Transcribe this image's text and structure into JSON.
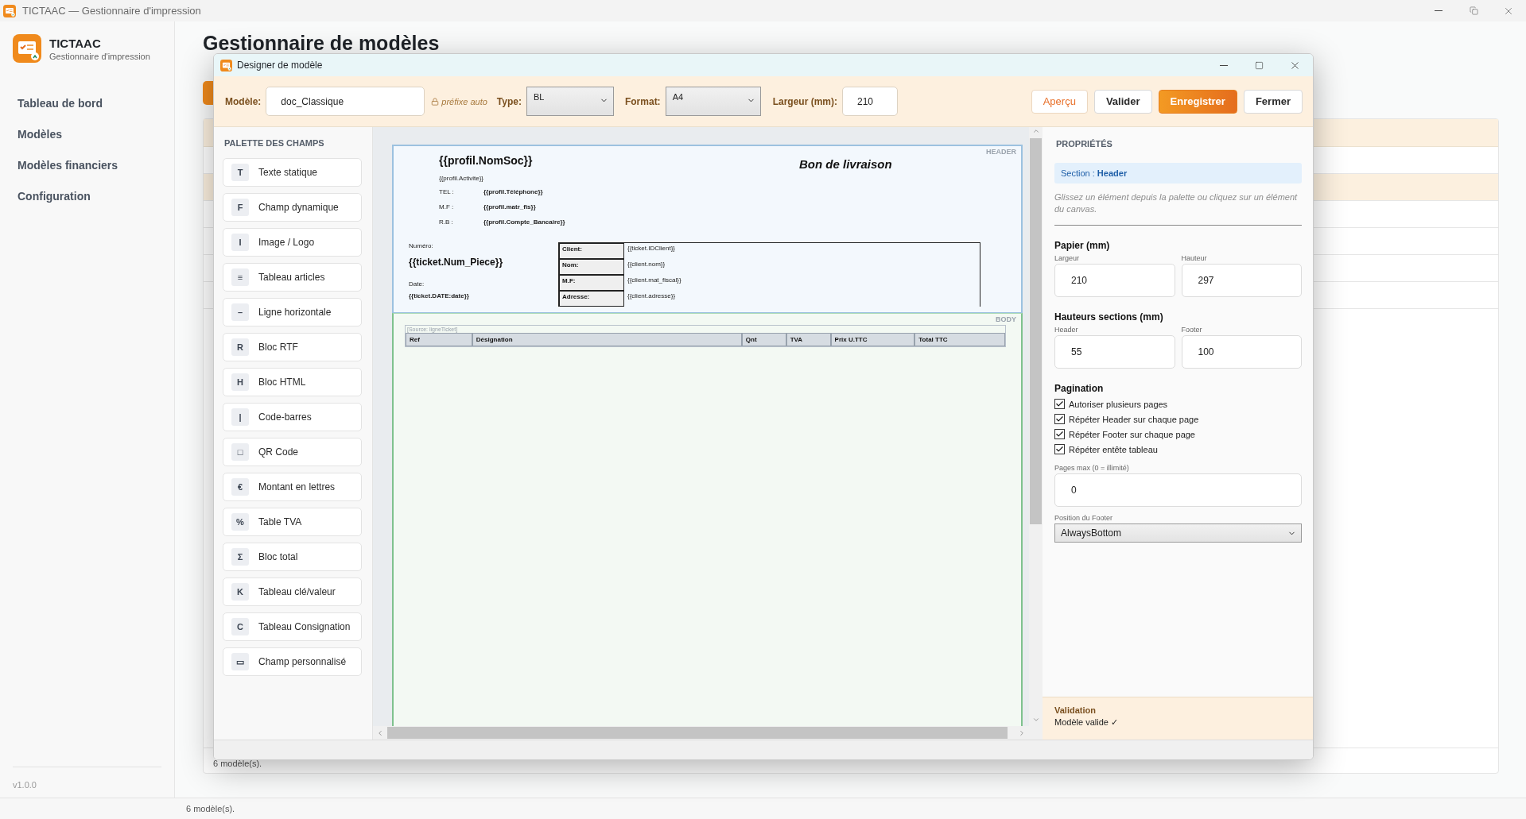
{
  "app_window": {
    "title": "TICTAAC — Gestionnaire d'impression"
  },
  "sidebar": {
    "app_name": "TICTAAC",
    "app_subtitle": "Gestionnaire d'impression",
    "items": [
      {
        "label": "Tableau de bord"
      },
      {
        "label": "Modèles"
      },
      {
        "label": "Modèles financiers"
      },
      {
        "label": "Configuration"
      }
    ],
    "version": "v1.0.0"
  },
  "main": {
    "title": "Gestionnaire de modèles",
    "table_rows": [
      {
        "selected": false
      },
      {
        "selected": true
      },
      {
        "selected": false
      },
      {
        "selected": false
      },
      {
        "selected": false
      },
      {
        "selected": false
      }
    ],
    "list_footer": "6 modèle(s)."
  },
  "status_bar": {
    "text": "6 modèle(s)."
  },
  "dialog": {
    "title": "Designer de modèle",
    "toolbar": {
      "model_label": "Modèle:",
      "model_value": "doc_Classique",
      "prefix_hint": "préfixe auto",
      "type_label": "Type:",
      "type_value": "BL",
      "format_label": "Format:",
      "format_value": "A4",
      "width_label": "Largeur (mm):",
      "width_value": "210",
      "buttons": [
        {
          "label": "Aperçu",
          "kind": "outline"
        },
        {
          "label": "Valider",
          "kind": "plain"
        },
        {
          "label": "Enregistrer",
          "kind": "primary"
        },
        {
          "label": "Fermer",
          "kind": "plain"
        }
      ]
    },
    "palette": {
      "title": "PALETTE DES CHAMPS",
      "items": [
        {
          "glyph": "T",
          "label": "Texte statique"
        },
        {
          "glyph": "F",
          "label": "Champ dynamique"
        },
        {
          "glyph": "I",
          "label": "Image / Logo"
        },
        {
          "glyph": "≡",
          "label": "Tableau articles"
        },
        {
          "glyph": "–",
          "label": "Ligne horizontale"
        },
        {
          "glyph": "R",
          "label": "Bloc RTF"
        },
        {
          "glyph": "H",
          "label": "Bloc HTML"
        },
        {
          "glyph": "|",
          "label": "Code-barres"
        },
        {
          "glyph": "□",
          "label": "QR Code"
        },
        {
          "glyph": "€",
          "label": "Montant en lettres"
        },
        {
          "glyph": "%",
          "label": "Table TVA"
        },
        {
          "glyph": "Σ",
          "label": "Bloc total"
        },
        {
          "glyph": "K",
          "label": "Tableau clé/valeur"
        },
        {
          "glyph": "C",
          "label": "Tableau Consignation"
        },
        {
          "glyph": "▭",
          "label": "Champ personnalisé"
        }
      ]
    },
    "canvas": {
      "header_section": {
        "label": "HEADER",
        "company": "{{profil.NomSoc}}",
        "activity": "{{profil.Activite}}",
        "info_rows": [
          {
            "label": "TEL :",
            "value": "{{profil.Téléphone}}"
          },
          {
            "label": "M.F :",
            "value": "{{profil.matr_fis}}"
          },
          {
            "label": "R.B :",
            "value": "{{profil.Compte_Bancaire}}"
          }
        ],
        "doc_title": "Bon de livraison",
        "number_label": "Numéro:",
        "number_value": "{{ticket.Num_Piece}}",
        "date_label": "Date:",
        "date_value": "{{ticket.DATE:date}}",
        "client_rows": [
          {
            "label": "Client:",
            "value": "{{ticket.IDClient}}"
          },
          {
            "label": "Nom:",
            "value": "{{client.nom}}"
          },
          {
            "label": "M.F:",
            "value": "{{client.mat_fiscal}}"
          },
          {
            "label": "Adresse:",
            "value": "{{client.adresse}}"
          }
        ]
      },
      "body_section": {
        "label": "BODY",
        "source": "[Source: ligneTicket]",
        "columns": [
          "Ref",
          "Désignation",
          "Qnt",
          "TVA",
          "Prix U.TTC",
          "Total TTC"
        ]
      }
    },
    "properties": {
      "title": "PROPRIÉTÉS",
      "section": "Section : **Header**",
      "hint": "Glissez un élément depuis la palette ou cliquez sur un élément du canvas.",
      "paper": {
        "title": "Papier (mm)",
        "fields": [
          {
            "label": "Largeur",
            "value": "210"
          },
          {
            "label": "Hauteur",
            "value": "297"
          }
        ]
      },
      "sections": {
        "title": "Hauteurs sections (mm)",
        "fields": [
          {
            "label": "Header",
            "value": "55"
          },
          {
            "label": "Footer",
            "value": "100"
          }
        ]
      },
      "pagination": {
        "title": "Pagination",
        "options": [
          {
            "label": "Autoriser plusieurs pages",
            "checked": true
          },
          {
            "label": "Répéter Header sur chaque page",
            "checked": true
          },
          {
            "label": "Répéter Footer sur chaque page",
            "checked": true
          },
          {
            "label": "Répéter entête tableau",
            "checked": true
          }
        ],
        "max_label": "Pages max (0 = illimité)",
        "max_value": "0",
        "footer_pos_label": "Position du Footer",
        "footer_pos_value": "AlwaysBottom"
      },
      "validation": {
        "title": "Validation",
        "message": "Modèle valide ✓"
      }
    }
  }
}
